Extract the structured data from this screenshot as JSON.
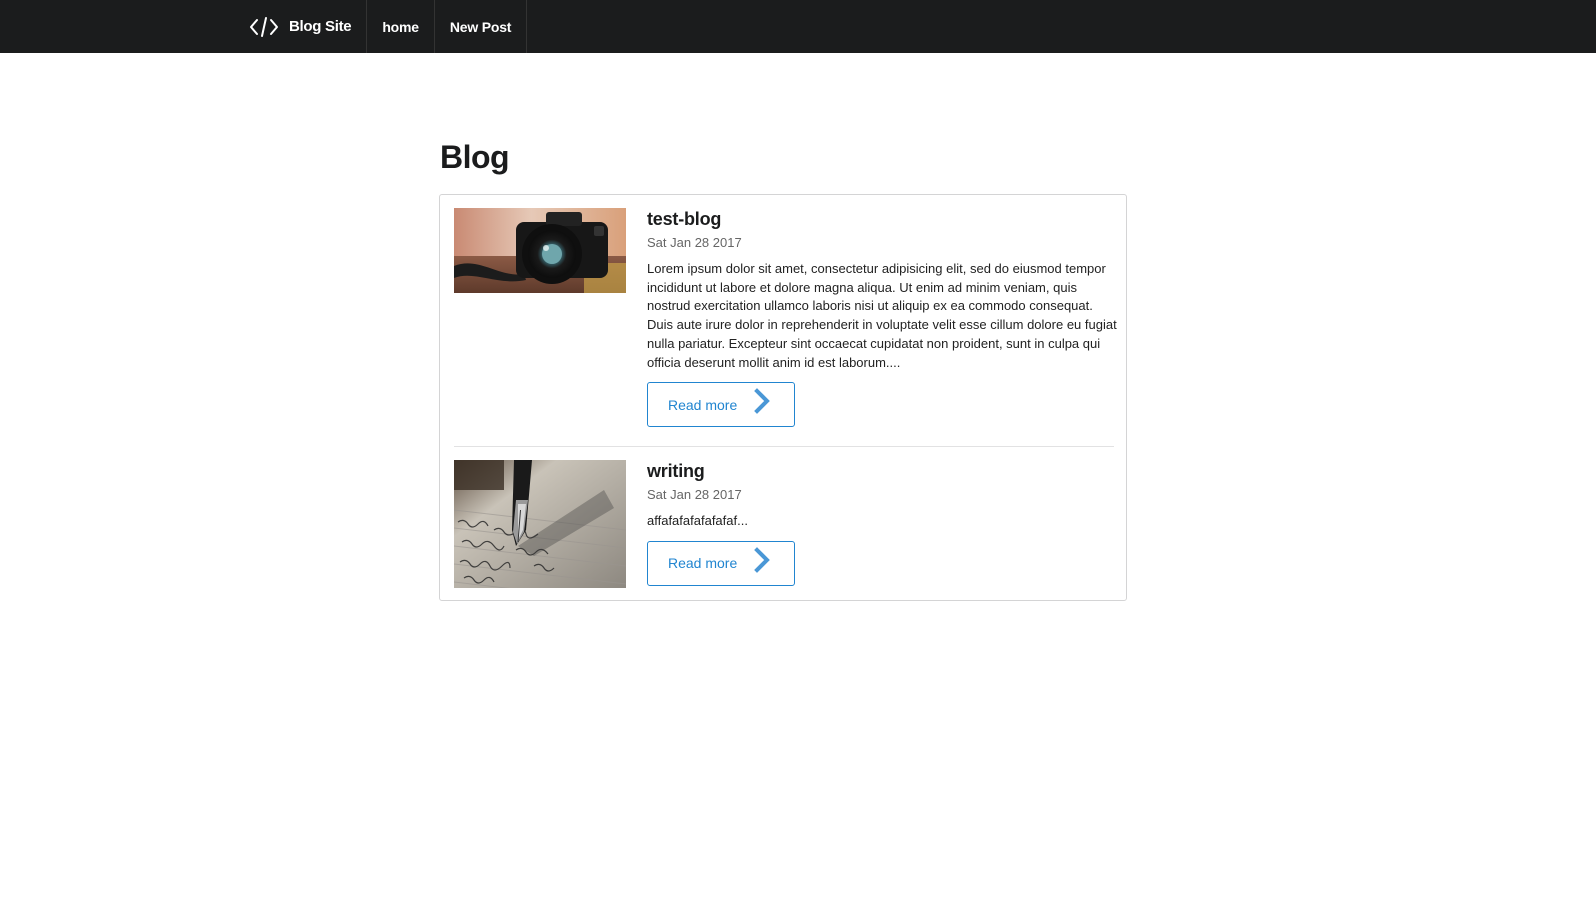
{
  "navbar": {
    "brand_icon": "code-icon",
    "brand_label": "Blog Site",
    "items": [
      {
        "label": "home"
      },
      {
        "label": "New Post"
      }
    ]
  },
  "page": {
    "title": "Blog"
  },
  "posts": [
    {
      "title": "test-blog",
      "date": "Sat Jan 28 2017",
      "excerpt": "Lorem ipsum dolor sit amet, consectetur adipisicing elit, sed do eiusmod tempor incididunt ut labore et dolore magna aliqua. Ut enim ad minim veniam, quis nostrud exercitation ullamco laboris nisi ut aliquip ex ea commodo consequat. Duis aute irure dolor in reprehenderit in voluptate velit esse cillum dolore eu fugiat nulla pariatur. Excepteur sint occaecat cupidatat non proident, sunt in culpa qui officia deserunt mollit anim id est laborum....",
      "thumbnail": "camera-photo",
      "read_more_label": "Read more",
      "read_more_icon": "chevron-right-icon"
    },
    {
      "title": "writing",
      "date": "Sat Jan 28 2017",
      "excerpt": "affafafafafafafaf...",
      "thumbnail": "fountain-pen-photo",
      "read_more_label": "Read more",
      "read_more_icon": "chevron-right-icon"
    }
  ],
  "colors": {
    "navbar_bg": "#1b1c1d",
    "accent": "#2185d0"
  }
}
